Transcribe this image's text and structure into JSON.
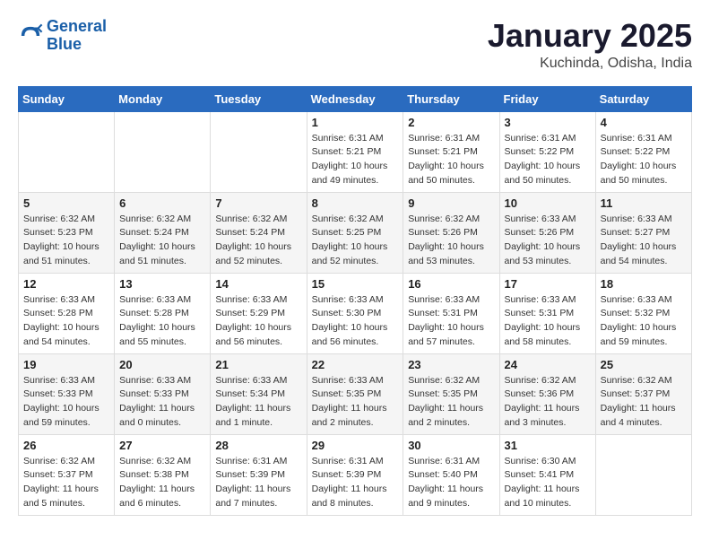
{
  "header": {
    "logo_line1": "General",
    "logo_line2": "Blue",
    "month": "January 2025",
    "location": "Kuchinda, Odisha, India"
  },
  "weekdays": [
    "Sunday",
    "Monday",
    "Tuesday",
    "Wednesday",
    "Thursday",
    "Friday",
    "Saturday"
  ],
  "weeks": [
    [
      {
        "day": "",
        "info": ""
      },
      {
        "day": "",
        "info": ""
      },
      {
        "day": "",
        "info": ""
      },
      {
        "day": "1",
        "info": "Sunrise: 6:31 AM\nSunset: 5:21 PM\nDaylight: 10 hours\nand 49 minutes."
      },
      {
        "day": "2",
        "info": "Sunrise: 6:31 AM\nSunset: 5:21 PM\nDaylight: 10 hours\nand 50 minutes."
      },
      {
        "day": "3",
        "info": "Sunrise: 6:31 AM\nSunset: 5:22 PM\nDaylight: 10 hours\nand 50 minutes."
      },
      {
        "day": "4",
        "info": "Sunrise: 6:31 AM\nSunset: 5:22 PM\nDaylight: 10 hours\nand 50 minutes."
      }
    ],
    [
      {
        "day": "5",
        "info": "Sunrise: 6:32 AM\nSunset: 5:23 PM\nDaylight: 10 hours\nand 51 minutes."
      },
      {
        "day": "6",
        "info": "Sunrise: 6:32 AM\nSunset: 5:24 PM\nDaylight: 10 hours\nand 51 minutes."
      },
      {
        "day": "7",
        "info": "Sunrise: 6:32 AM\nSunset: 5:24 PM\nDaylight: 10 hours\nand 52 minutes."
      },
      {
        "day": "8",
        "info": "Sunrise: 6:32 AM\nSunset: 5:25 PM\nDaylight: 10 hours\nand 52 minutes."
      },
      {
        "day": "9",
        "info": "Sunrise: 6:32 AM\nSunset: 5:26 PM\nDaylight: 10 hours\nand 53 minutes."
      },
      {
        "day": "10",
        "info": "Sunrise: 6:33 AM\nSunset: 5:26 PM\nDaylight: 10 hours\nand 53 minutes."
      },
      {
        "day": "11",
        "info": "Sunrise: 6:33 AM\nSunset: 5:27 PM\nDaylight: 10 hours\nand 54 minutes."
      }
    ],
    [
      {
        "day": "12",
        "info": "Sunrise: 6:33 AM\nSunset: 5:28 PM\nDaylight: 10 hours\nand 54 minutes."
      },
      {
        "day": "13",
        "info": "Sunrise: 6:33 AM\nSunset: 5:28 PM\nDaylight: 10 hours\nand 55 minutes."
      },
      {
        "day": "14",
        "info": "Sunrise: 6:33 AM\nSunset: 5:29 PM\nDaylight: 10 hours\nand 56 minutes."
      },
      {
        "day": "15",
        "info": "Sunrise: 6:33 AM\nSunset: 5:30 PM\nDaylight: 10 hours\nand 56 minutes."
      },
      {
        "day": "16",
        "info": "Sunrise: 6:33 AM\nSunset: 5:31 PM\nDaylight: 10 hours\nand 57 minutes."
      },
      {
        "day": "17",
        "info": "Sunrise: 6:33 AM\nSunset: 5:31 PM\nDaylight: 10 hours\nand 58 minutes."
      },
      {
        "day": "18",
        "info": "Sunrise: 6:33 AM\nSunset: 5:32 PM\nDaylight: 10 hours\nand 59 minutes."
      }
    ],
    [
      {
        "day": "19",
        "info": "Sunrise: 6:33 AM\nSunset: 5:33 PM\nDaylight: 10 hours\nand 59 minutes."
      },
      {
        "day": "20",
        "info": "Sunrise: 6:33 AM\nSunset: 5:33 PM\nDaylight: 11 hours\nand 0 minutes."
      },
      {
        "day": "21",
        "info": "Sunrise: 6:33 AM\nSunset: 5:34 PM\nDaylight: 11 hours\nand 1 minute."
      },
      {
        "day": "22",
        "info": "Sunrise: 6:33 AM\nSunset: 5:35 PM\nDaylight: 11 hours\nand 2 minutes."
      },
      {
        "day": "23",
        "info": "Sunrise: 6:32 AM\nSunset: 5:35 PM\nDaylight: 11 hours\nand 2 minutes."
      },
      {
        "day": "24",
        "info": "Sunrise: 6:32 AM\nSunset: 5:36 PM\nDaylight: 11 hours\nand 3 minutes."
      },
      {
        "day": "25",
        "info": "Sunrise: 6:32 AM\nSunset: 5:37 PM\nDaylight: 11 hours\nand 4 minutes."
      }
    ],
    [
      {
        "day": "26",
        "info": "Sunrise: 6:32 AM\nSunset: 5:37 PM\nDaylight: 11 hours\nand 5 minutes."
      },
      {
        "day": "27",
        "info": "Sunrise: 6:32 AM\nSunset: 5:38 PM\nDaylight: 11 hours\nand 6 minutes."
      },
      {
        "day": "28",
        "info": "Sunrise: 6:31 AM\nSunset: 5:39 PM\nDaylight: 11 hours\nand 7 minutes."
      },
      {
        "day": "29",
        "info": "Sunrise: 6:31 AM\nSunset: 5:39 PM\nDaylight: 11 hours\nand 8 minutes."
      },
      {
        "day": "30",
        "info": "Sunrise: 6:31 AM\nSunset: 5:40 PM\nDaylight: 11 hours\nand 9 minutes."
      },
      {
        "day": "31",
        "info": "Sunrise: 6:30 AM\nSunset: 5:41 PM\nDaylight: 11 hours\nand 10 minutes."
      },
      {
        "day": "",
        "info": ""
      }
    ]
  ]
}
